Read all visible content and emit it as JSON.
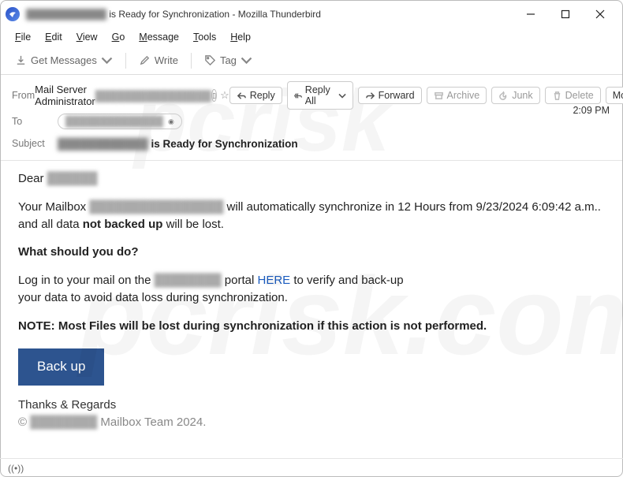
{
  "window": {
    "title_prefix": "████████████",
    "title_suffix": " is Ready for Synchronization - Mozilla Thunderbird"
  },
  "menu": {
    "file": "File",
    "edit": "Edit",
    "view": "View",
    "go": "Go",
    "message": "Message",
    "tools": "Tools",
    "help": "Help"
  },
  "toolbar": {
    "get_messages": "Get Messages",
    "write": "Write",
    "tag": "Tag"
  },
  "header": {
    "from_label": "From",
    "from_name": "Mail Server Administrator",
    "from_email_masked": "████████████████",
    "to_label": "To",
    "to_masked": "██████████████",
    "subject_label": "Subject",
    "subject_prefix_masked": "████████████",
    "subject_suffix": "is Ready for Synchronization",
    "time": "2:09 PM",
    "actions": {
      "reply": "Reply",
      "reply_all": "Reply All",
      "forward": "Forward",
      "archive": "Archive",
      "junk": "Junk",
      "delete": "Delete",
      "more": "More"
    }
  },
  "body": {
    "dear": "Dear",
    "dear_name_masked": "██████",
    "p1_a": "Your Mailbox ",
    "p1_mask": "████████████████",
    "p1_b": " will automatically synchronize in 12 Hours from 9/23/2024 6:09:42 a.m.. and all data ",
    "p1_bold": "not backed up",
    "p1_c": " will be lost.",
    "q": "What should you do?",
    "p2_a": "Log in to your mail on the ",
    "p2_mask": "████████",
    "p2_b": " portal     ",
    "p2_link": "HERE",
    "p2_c": "     to verify and back-up",
    "p2_d": "your data to avoid data loss during synchronization.",
    "note": "NOTE: Most Files will be lost during synchronization if this action is not performed.",
    "backup_btn": "Back up",
    "thanks": "Thanks & Regards",
    "copy_prefix": "© ",
    "copy_mask": "████████",
    "copy_suffix": " Mailbox Team 2024."
  },
  "status": {
    "icon": "((•))"
  }
}
